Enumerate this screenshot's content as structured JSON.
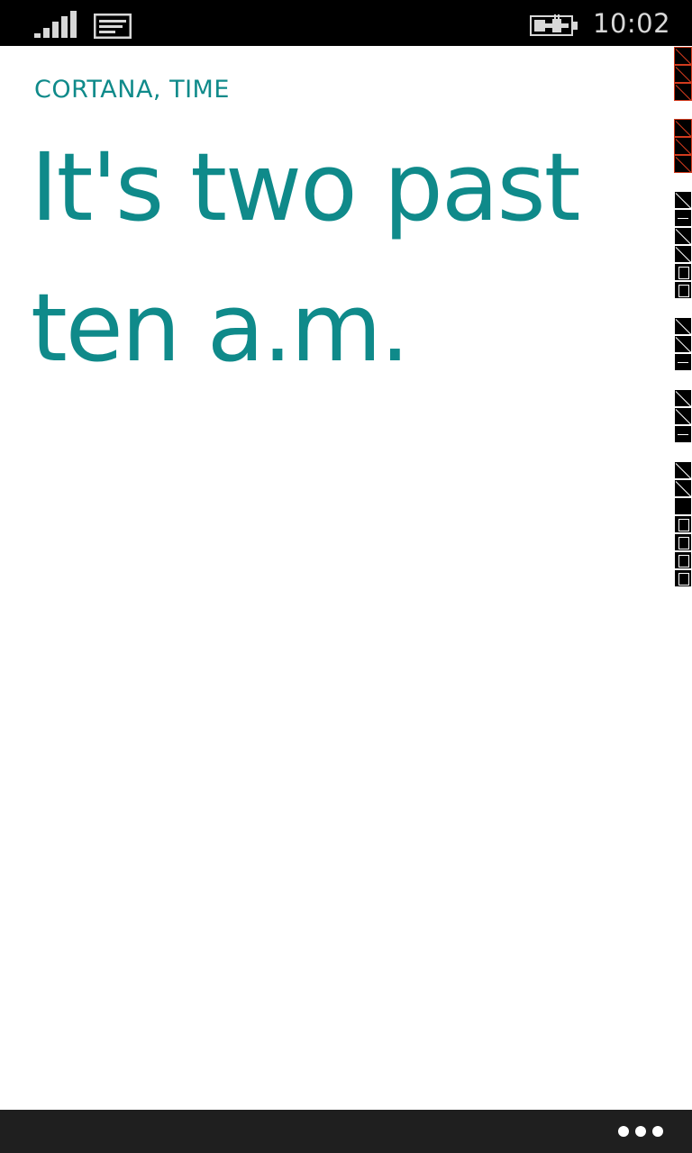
{
  "status_bar": {
    "time": "10:02",
    "signal_icon": "signal-strength-icon",
    "message_icon": "message-icon",
    "battery_icon": "battery-charging-icon"
  },
  "header": {
    "title": "CORTANA, TIME"
  },
  "main": {
    "answer": "It's two past ten a.m."
  },
  "app_bar": {
    "more_icon": "more-icon"
  },
  "colors": {
    "accent": "#0f8a8a",
    "status_bar_bg": "#000000",
    "app_bar_bg": "#1f1f1f",
    "background": "#ffffff"
  }
}
